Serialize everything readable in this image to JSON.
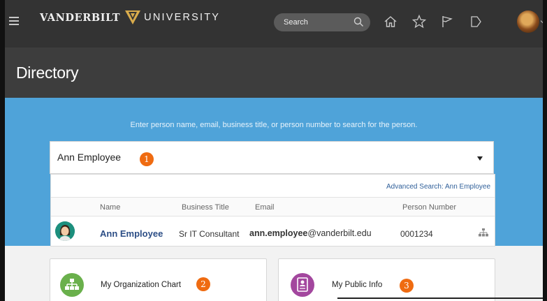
{
  "header": {
    "brand_left": "VANDERBILT",
    "brand_right": "UNIVERSITY",
    "search_placeholder": "Search",
    "icons": [
      "menu-icon",
      "home-icon",
      "star-icon",
      "flag-icon",
      "notifications-icon",
      "user-avatar"
    ]
  },
  "page": {
    "title": "Directory"
  },
  "search": {
    "hint": "Enter person name, email, business title, or person number to search for the person.",
    "value": "Ann Employee",
    "advanced_link": "Advanced Search: Ann Employee",
    "columns": [
      "Name",
      "Business Title",
      "Email",
      "Person Number"
    ],
    "result": {
      "name": "Ann Employee",
      "business_title": "Sr IT Consultant",
      "email_user": "ann.employee",
      "email_domain": "@vanderbilt.edu",
      "person_number": "0001234"
    }
  },
  "cards": [
    {
      "label": "My Organization Chart",
      "color": "#6ab04c"
    },
    {
      "label": "My Public Info",
      "color": "#a3479e"
    }
  ],
  "callouts": [
    "1",
    "2",
    "3"
  ],
  "colors": {
    "topbar": "#333333",
    "titlebar": "#3d3d3d",
    "search_panel": "#4fa3d9",
    "callout": "#ef6b11",
    "link": "#2c4e86"
  }
}
